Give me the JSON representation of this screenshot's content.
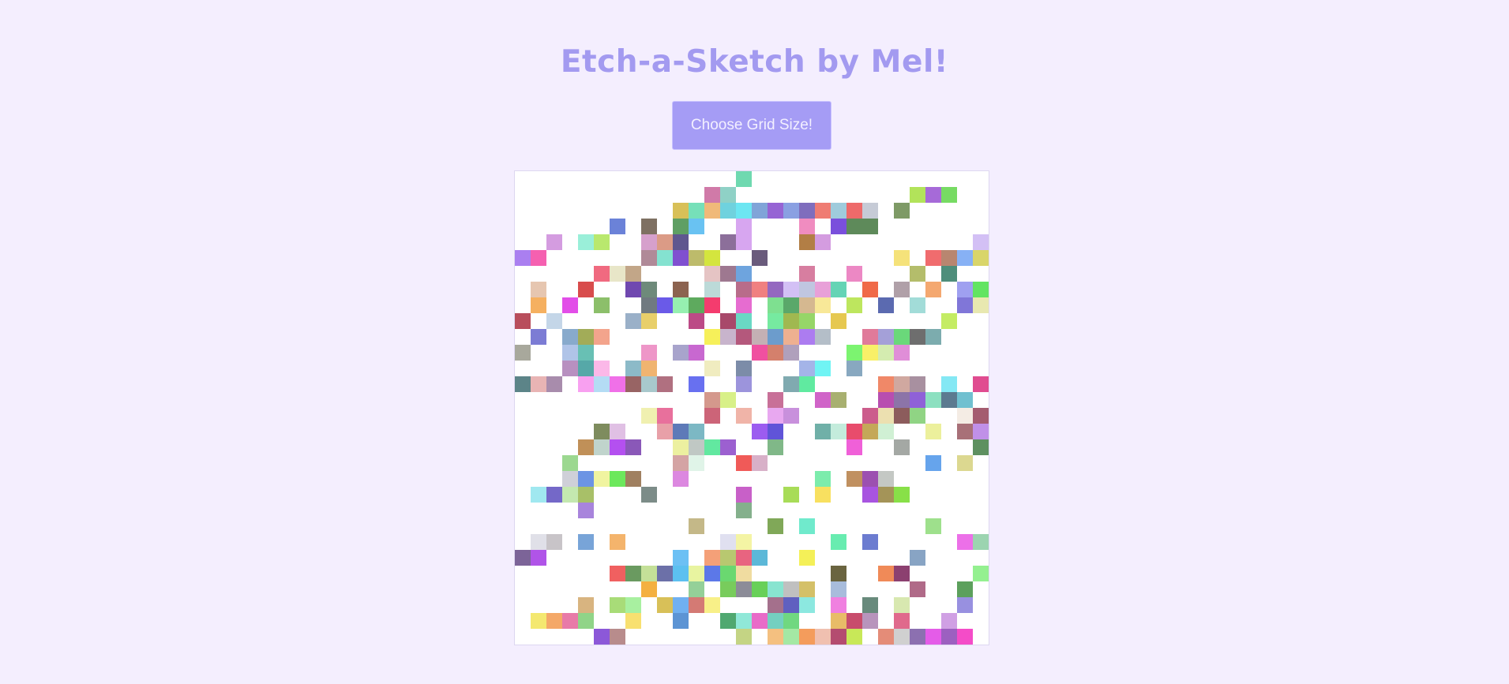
{
  "header": {
    "title": "Etch-a-Sketch by Mel!"
  },
  "controls": {
    "grid_size_button": "Choose Grid Size!"
  },
  "grid": {
    "size": 30,
    "default_color": "#ffffff",
    "palette": [
      "#6fd9b0",
      "#d07aa8",
      "#8fd1c6",
      "#76e0b9",
      "#f0b979",
      "#6fd2de",
      "#6ce6f2",
      "#80a4d8",
      "#9664d4",
      "#8aa0e2",
      "#7f6dbd",
      "#ef7c73",
      "#9fcbdc",
      "#ee6a6a",
      "#c6cbd6",
      "#7e9a66",
      "#b2e35a",
      "#a66ad8",
      "#77db63",
      "#6b82d8",
      "#7e7062",
      "#5f9f63",
      "#69c2f2",
      "#d7a6f0",
      "#f08cc0",
      "#7a4fdc",
      "#5e8a5a",
      "#b27e45",
      "#d49ce0",
      "#9aefd9",
      "#b9e86e",
      "#d6a0cc",
      "#db9b86",
      "#5f578f",
      "#8c6f9a",
      "#f36270",
      "#9a4db4",
      "#747474",
      "#cfe8bb",
      "#5c97ec",
      "#aa7ff0",
      "#f560b0",
      "#b08a98",
      "#84e2d0",
      "#8050d0",
      "#bdbb6b",
      "#d4e53e",
      "#6a5b7c",
      "#f5e27a",
      "#f06c6e",
      "#b88670",
      "#87b1f5",
      "#d9d56a",
      "#f06a80",
      "#e8e6c8",
      "#c2a688",
      "#e5c4c4",
      "#9e7890",
      "#6ea4de",
      "#d77ea0",
      "#ec88c4",
      "#b4bd6b",
      "#4e8e7b",
      "#e6c6b0",
      "#d84c4c",
      "#7048b0",
      "#6e8a7a",
      "#8c6350",
      "#bcdad8",
      "#b86c8a",
      "#f08080",
      "#9468c0",
      "#d3c0f5",
      "#c0c6e0",
      "#e8a0d8",
      "#65d4b5",
      "#f06a48",
      "#b0a0a8",
      "#f4a870",
      "#9fa0f0",
      "#62e462",
      "#f5b060",
      "#e24ee8",
      "#8cbf6a",
      "#707a80",
      "#6a5ae8",
      "#96f0b0",
      "#5eaa5e",
      "#f43c6e",
      "#e66cd0",
      "#7ee090",
      "#5aa86a",
      "#d5b890",
      "#f8e898",
      "#bde65e",
      "#5b6ab0",
      "#a2dcd8",
      "#8076d8",
      "#e8e8b0",
      "#b84e5c",
      "#c4d6e8",
      "#9ab0c8",
      "#e8cf6a",
      "#bc4a86",
      "#a8486a",
      "#6ad8c4",
      "#76eaa0",
      "#a0b850",
      "#96d668",
      "#e6c850",
      "#c4ec64",
      "#7c7cd4",
      "#88aacc",
      "#a2ac58",
      "#f3a48c",
      "#f6f05a",
      "#c8b4cc",
      "#b4587c",
      "#c4b0b4",
      "#6c9ccc",
      "#eeb090",
      "#ac7cf0",
      "#b4bec8",
      "#e07a9a",
      "#a4a0d8",
      "#6ad87a",
      "#6e6e6e",
      "#7cacae",
      "#a8a89c",
      "#b0c4e8",
      "#68c0b4",
      "#ee96c8",
      "#a8a4cc",
      "#c868d0",
      "#f050a0",
      "#d4806c",
      "#b0a0bc",
      "#7cf470",
      "#f8f068",
      "#d4ecb0",
      "#e08ed8",
      "#b890c0",
      "#56a8a8",
      "#fbb8e8",
      "#8cbac8",
      "#f0b470",
      "#f0ecc0",
      "#7c8ca8",
      "#a4b4e8",
      "#70f4f4",
      "#88a8c0",
      "#5c8488",
      "#e8b4b4",
      "#a88cac",
      "#f8a0f0",
      "#b4dcf4",
      "#f070e8",
      "#986464",
      "#a8c8cc",
      "#b07080",
      "#6870f0",
      "#9c94dc",
      "#80aab0",
      "#60eaa0",
      "#f08868",
      "#d0a8a0",
      "#a890a0",
      "#84e8f4",
      "#e04c90",
      "#d4988c",
      "#d8f088",
      "#c87098",
      "#d064c8",
      "#a8b070",
      "#b84eb0",
      "#8c74a8",
      "#8f61d8",
      "#8ce0c0",
      "#5c7a90",
      "#70c0d0",
      "#f0f0b0",
      "#e8709c",
      "#cc6478",
      "#f0b4a8",
      "#e8a8f0",
      "#c890dc",
      "#cc5c8c",
      "#ece0b0",
      "#8c5c5c",
      "#90d484",
      "#f4ece4",
      "#a45c70",
      "#7e8c5e",
      "#e0c0e4",
      "#e8a0a8",
      "#5e7ab8",
      "#7cb8c4",
      "#9c5cf0",
      "#6054d8",
      "#70b0a8",
      "#c4ecdc",
      "#e84c6c",
      "#c4a858",
      "#d0f0d4",
      "#ecf09c",
      "#a87078",
      "#c090e8",
      "#c09058",
      "#c0d4cc",
      "#b450f0",
      "#8a58b8",
      "#ecf0a0",
      "#c0c8c4",
      "#62e8a0",
      "#9c60d0",
      "#80b888",
      "#f060d8",
      "#a4a8a4",
      "#5e9060",
      "#9cd890",
      "#d4a4a4",
      "#e0f4e8",
      "#f05a58",
      "#d8b0c8",
      "#66a4ec",
      "#dcd890",
      "#cfd0d8",
      "#6c94e4",
      "#f0f4a0",
      "#6ce85c",
      "#a08060",
      "#dc88e0",
      "#7cecac",
      "#c09060",
      "#9c50b0",
      "#c4c8c4",
      "#a0e8f0",
      "#7468c8",
      "#c4e8b0",
      "#a8c068",
      "#7c8c88",
      "#c860c8",
      "#a8dc58",
      "#f8e060",
      "#a854e0",
      "#a49458",
      "#88e048",
      "#a884dc",
      "#84b08c",
      "#c4b888",
      "#80a858",
      "#70eacc",
      "#9ee08c",
      "#e0e0e8",
      "#c8c4c8",
      "#78a4d8",
      "#f4b46c",
      "#e0e0f0",
      "#f4f4a4",
      "#68ecb0",
      "#6c7cd0",
      "#ec70e8",
      "#9cd4b0",
      "#7c6498",
      "#b054e8",
      "#6cc0f4",
      "#f4a078",
      "#b8c870",
      "#e86480",
      "#5cb8d8",
      "#f4f058",
      "#88a4c4",
      "#f06060",
      "#6a9a60",
      "#c4e098",
      "#6c70a8",
      "#5cc0f0",
      "#e8f4a0",
      "#5c78e8",
      "#6ad870",
      "#f0dca0",
      "#6a6440",
      "#f08a58",
      "#8c4070",
      "#94f090",
      "#f4b040",
      "#94d098",
      "#78cc5c",
      "#8c8c98",
      "#68d058",
      "#88e4d0",
      "#c0c0c0",
      "#d4c068",
      "#a8bcdc",
      "#b06a88",
      "#5ca05c",
      "#d8b480",
      "#a8dc78",
      "#a8f0a0",
      "#d8c058",
      "#70b0f0",
      "#d47a74",
      "#f8f088",
      "#a4708c",
      "#6060c0",
      "#8ce8e0",
      "#f080e0",
      "#688a7c",
      "#d8e8b0",
      "#9890e0",
      "#f4e870",
      "#f4a868",
      "#e87aa8",
      "#90d488",
      "#f8e070",
      "#5c94d4",
      "#50a870",
      "#90e8d8",
      "#e86cc8",
      "#74d0c0",
      "#70d880",
      "#e8bc68",
      "#c84c6c",
      "#b894bc",
      "#e06a8c",
      "#d0a0e4",
      "#8c58d8",
      "#b88c8c",
      "#c4d484",
      "#f4c080",
      "#a4e8a4",
      "#f49c5c",
      "#f0c0b0",
      "#b44c70",
      "#c8e858",
      "#e48c78",
      "#d0d0d0",
      "#8c70b0",
      "#e45ce8",
      "#9c60c0",
      "#f44cc8"
    ],
    "cells": [
      [
        0,
        0,
        0,
        0,
        0,
        0,
        0,
        0,
        0,
        0,
        0,
        0,
        0,
        0,
        1,
        0,
        0,
        0,
        0,
        0,
        0,
        0,
        0,
        0,
        0,
        0,
        0,
        0,
        0,
        0
      ],
      [
        0,
        0,
        0,
        0,
        0,
        0,
        0,
        0,
        0,
        0,
        0,
        0,
        2,
        3,
        0,
        0,
        0,
        0,
        0,
        0,
        0,
        0,
        0,
        0,
        0,
        17,
        18,
        19,
        0,
        0
      ],
      [
        0,
        0,
        0,
        0,
        0,
        0,
        0,
        0,
        0,
        0,
        300,
        4,
        5,
        6,
        7,
        8,
        9,
        10,
        11,
        12,
        13,
        14,
        15,
        0,
        16,
        0,
        0,
        0,
        0,
        0
      ],
      [
        0,
        0,
        0,
        0,
        0,
        0,
        20,
        0,
        21,
        0,
        22,
        23,
        0,
        0,
        24,
        0,
        0,
        0,
        25,
        0,
        26,
        27,
        27,
        0,
        0,
        0,
        0,
        0,
        0,
        0
      ],
      [
        0,
        0,
        29,
        0,
        30,
        31,
        0,
        0,
        32,
        33,
        34,
        0,
        0,
        35,
        24,
        0,
        0,
        0,
        28,
        29,
        0,
        0,
        0,
        0,
        0,
        0,
        0,
        0,
        0,
        73
      ],
      [
        41,
        42,
        0,
        0,
        0,
        0,
        0,
        0,
        43,
        44,
        45,
        46,
        47,
        0,
        0,
        48,
        0,
        0,
        0,
        0,
        0,
        0,
        0,
        0,
        49,
        0,
        50,
        51,
        52,
        53
      ],
      [
        0,
        0,
        0,
        0,
        0,
        54,
        55,
        56,
        0,
        0,
        0,
        0,
        57,
        58,
        59,
        0,
        0,
        0,
        60,
        0,
        0,
        61,
        0,
        0,
        0,
        62,
        0,
        63,
        0,
        0
      ],
      [
        0,
        64,
        0,
        0,
        65,
        0,
        0,
        66,
        67,
        0,
        68,
        0,
        69,
        0,
        70,
        71,
        72,
        73,
        74,
        75,
        76,
        0,
        77,
        0,
        78,
        0,
        79,
        0,
        80,
        81
      ],
      [
        0,
        82,
        0,
        83,
        0,
        84,
        0,
        0,
        85,
        86,
        87,
        88,
        89,
        0,
        90,
        0,
        91,
        92,
        93,
        94,
        0,
        95,
        0,
        96,
        0,
        97,
        0,
        0,
        98,
        99
      ],
      [
        100,
        0,
        101,
        0,
        0,
        0,
        0,
        102,
        103,
        0,
        0,
        104,
        0,
        105,
        106,
        0,
        107,
        108,
        109,
        0,
        110,
        0,
        0,
        0,
        0,
        0,
        0,
        111,
        0,
        0
      ],
      [
        0,
        112,
        0,
        113,
        114,
        115,
        0,
        0,
        0,
        0,
        0,
        0,
        116,
        117,
        118,
        119,
        120,
        121,
        122,
        123,
        0,
        0,
        124,
        125,
        126,
        127,
        128,
        0,
        0,
        0
      ],
      [
        129,
        0,
        0,
        130,
        131,
        0,
        0,
        0,
        132,
        0,
        133,
        134,
        0,
        0,
        0,
        135,
        136,
        137,
        0,
        0,
        0,
        138,
        139,
        140,
        141,
        0,
        0,
        0,
        0,
        0
      ],
      [
        0,
        0,
        0,
        142,
        143,
        144,
        0,
        145,
        146,
        0,
        0,
        0,
        147,
        0,
        148,
        0,
        0,
        0,
        149,
        150,
        0,
        151,
        0,
        0,
        0,
        0,
        0,
        0,
        0,
        0
      ],
      [
        152,
        153,
        154,
        0,
        155,
        156,
        157,
        158,
        159,
        160,
        0,
        161,
        0,
        0,
        162,
        0,
        0,
        163,
        164,
        0,
        0,
        0,
        0,
        165,
        166,
        167,
        0,
        168,
        0,
        169
      ],
      [
        0,
        0,
        0,
        0,
        0,
        0,
        0,
        0,
        0,
        0,
        0,
        0,
        170,
        171,
        0,
        0,
        172,
        0,
        0,
        173,
        174,
        0,
        0,
        175,
        176,
        177,
        178,
        179,
        180,
        0
      ],
      [
        0,
        0,
        0,
        0,
        0,
        0,
        0,
        0,
        181,
        182,
        0,
        0,
        183,
        0,
        184,
        0,
        185,
        186,
        0,
        0,
        0,
        0,
        187,
        188,
        189,
        190,
        0,
        0,
        191,
        192
      ],
      [
        0,
        0,
        0,
        0,
        0,
        193,
        194,
        0,
        0,
        195,
        196,
        197,
        0,
        0,
        0,
        198,
        199,
        0,
        0,
        200,
        201,
        202,
        203,
        204,
        0,
        0,
        205,
        0,
        206,
        207
      ],
      [
        0,
        0,
        0,
        0,
        208,
        209,
        210,
        211,
        0,
        0,
        212,
        213,
        214,
        215,
        0,
        0,
        216,
        0,
        0,
        0,
        0,
        217,
        0,
        0,
        218,
        0,
        0,
        0,
        0,
        219
      ],
      [
        0,
        0,
        0,
        220,
        0,
        0,
        0,
        0,
        0,
        0,
        221,
        222,
        0,
        0,
        223,
        224,
        0,
        0,
        0,
        0,
        0,
        0,
        0,
        0,
        0,
        0,
        225,
        0,
        226,
        0
      ],
      [
        0,
        0,
        0,
        227,
        228,
        229,
        230,
        231,
        0,
        0,
        232,
        0,
        0,
        0,
        0,
        0,
        0,
        0,
        0,
        233,
        0,
        234,
        235,
        236,
        0,
        0,
        0,
        0,
        0,
        0
      ],
      [
        0,
        237,
        238,
        239,
        240,
        0,
        0,
        0,
        241,
        0,
        0,
        0,
        0,
        0,
        242,
        0,
        0,
        243,
        0,
        244,
        0,
        0,
        245,
        246,
        247,
        0,
        0,
        0,
        0,
        0
      ],
      [
        0,
        0,
        0,
        0,
        248,
        0,
        0,
        0,
        0,
        0,
        0,
        0,
        0,
        0,
        249,
        0,
        0,
        0,
        0,
        0,
        0,
        0,
        0,
        0,
        0,
        0,
        0,
        0,
        0,
        0
      ],
      [
        0,
        0,
        0,
        0,
        0,
        0,
        0,
        0,
        0,
        0,
        0,
        250,
        0,
        0,
        0,
        0,
        251,
        0,
        252,
        0,
        0,
        0,
        0,
        0,
        0,
        0,
        253,
        0,
        0,
        0
      ],
      [
        0,
        254,
        255,
        0,
        256,
        0,
        257,
        0,
        0,
        0,
        0,
        0,
        0,
        258,
        259,
        0,
        0,
        0,
        0,
        0,
        260,
        0,
        261,
        0,
        0,
        0,
        0,
        0,
        262,
        263
      ],
      [
        264,
        265,
        0,
        0,
        0,
        0,
        0,
        0,
        0,
        0,
        266,
        0,
        267,
        268,
        269,
        270,
        0,
        0,
        271,
        0,
        0,
        0,
        0,
        0,
        0,
        272,
        0,
        0,
        0,
        0
      ],
      [
        0,
        0,
        0,
        0,
        0,
        0,
        273,
        274,
        275,
        276,
        277,
        278,
        279,
        280,
        281,
        0,
        0,
        0,
        0,
        0,
        282,
        0,
        0,
        283,
        284,
        0,
        0,
        0,
        0,
        285
      ],
      [
        0,
        0,
        0,
        0,
        0,
        0,
        0,
        0,
        286,
        0,
        0,
        287,
        0,
        288,
        289,
        290,
        291,
        292,
        293,
        0,
        294,
        0,
        0,
        0,
        0,
        295,
        0,
        0,
        296,
        0
      ],
      [
        0,
        0,
        0,
        0,
        297,
        0,
        298,
        299,
        0,
        300,
        301,
        302,
        303,
        0,
        0,
        0,
        304,
        305,
        306,
        0,
        307,
        0,
        308,
        0,
        309,
        0,
        0,
        0,
        310,
        0
      ],
      [
        0,
        311,
        312,
        313,
        314,
        0,
        0,
        315,
        0,
        0,
        316,
        0,
        0,
        317,
        318,
        319,
        320,
        321,
        0,
        0,
        322,
        323,
        324,
        0,
        325,
        0,
        0,
        326,
        0,
        0
      ],
      [
        0,
        0,
        0,
        0,
        0,
        327,
        328,
        0,
        0,
        0,
        0,
        0,
        0,
        0,
        329,
        0,
        330,
        331,
        332,
        333,
        334,
        335,
        0,
        336,
        337,
        338,
        339,
        340,
        341,
        0
      ]
    ]
  }
}
